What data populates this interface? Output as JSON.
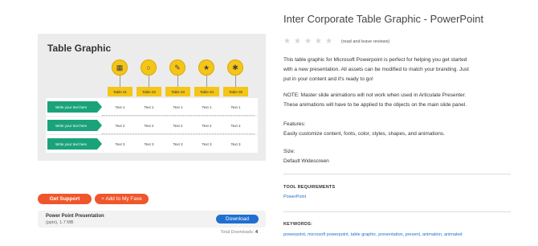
{
  "preview": {
    "slide_title": "Table Graphic",
    "columns": [
      "Table 01",
      "Table 02",
      "Table 03",
      "Table 04",
      "Table 05"
    ],
    "icons": [
      "building-icon",
      "coins-icon",
      "document-pen-icon",
      "network-icon",
      "share-icon"
    ],
    "rows": [
      {
        "label": "Write your text here",
        "cells": [
          "Text 1",
          "Text 1",
          "Text 1",
          "Text 1",
          "Text 1"
        ]
      },
      {
        "label": "Write your text here",
        "cells": [
          "Text 2",
          "Text 2",
          "Text 2",
          "Text 2",
          "Text 2"
        ]
      },
      {
        "label": "Write your text here",
        "cells": [
          "Text 3",
          "Text 3",
          "Text 3",
          "Text 3",
          "Text 3"
        ]
      }
    ]
  },
  "actions": {
    "get_support": "Get Support",
    "add_fave": "+ Add to My Fave"
  },
  "download": {
    "name": "Power Point Presentation",
    "size": "(pptx), 1.7 MB",
    "button": "Download",
    "total_label": "Total Downloads:",
    "total_value": "4"
  },
  "product": {
    "title": "Inter Corporate Table Graphic - PowerPoint",
    "reviews_link": "(read and leave reviews)",
    "desc1_line1": "This table graphic for Microsoft Powerpoint is perfect for helping you get started",
    "desc1_line2": "with a new presentation. All assets can be modified to match your branding. Just",
    "desc1_line3": "put in your content and it's ready to go!",
    "desc2_line1": "NOTE: Master slide animations will not work when used in Articulate Presenter.",
    "desc2_line2": "These animations will have to be applied to the objects on the main slide panel.",
    "features_label": "Features:",
    "features_text": "Easily customize content, fonts, color, styles, shapes, and animations.",
    "size_label": "Size:",
    "size_value": "Default Widescreen",
    "tool_req_head": "TOOL REQUIREMENTS",
    "tool_req_value": "PowerPoint",
    "keywords_head": "KEYWORDS:",
    "keywords": "powerpoint, microsoft powerpoint, table graphic, presentation, present, animation, animated"
  },
  "colors": {
    "accent_orange": "#f0562b",
    "download_blue": "#1f6fd1",
    "slide_yellow": "#f5c518",
    "slide_green": "#1aa37a"
  }
}
